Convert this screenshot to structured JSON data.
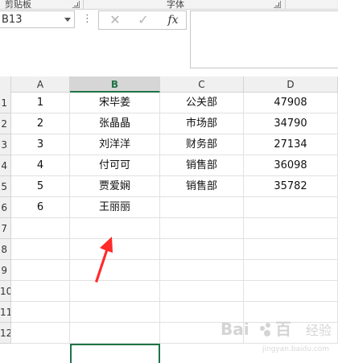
{
  "ribbon": {
    "clipboard_group": "剪贴板",
    "font_group": "字体"
  },
  "formula_bar": {
    "name_box": "B13",
    "more_icon": "vertical-dots-icon",
    "cancel_icon": "close-icon",
    "enter_icon": "check-icon",
    "insert_function_label": "fx",
    "value": ""
  },
  "sheet": {
    "columns": [
      "A",
      "B",
      "C",
      "D"
    ],
    "selected_column": "B",
    "row_headers": [
      "1",
      "2",
      "3",
      "4",
      "5",
      "6",
      "7",
      "8",
      "9",
      "10",
      "11",
      "12"
    ],
    "rows": [
      [
        "1",
        "宋毕姜",
        "公关部",
        "47908"
      ],
      [
        "2",
        "张晶晶",
        "市场部",
        "34790"
      ],
      [
        "3",
        "刘洋洋",
        "财务部",
        "27134"
      ],
      [
        "4",
        "付可可",
        "销售部",
        "36098"
      ],
      [
        "5",
        "贾爱娴",
        "销售部",
        "35782"
      ],
      [
        "6",
        "王丽丽",
        "",
        ""
      ],
      [
        "",
        "",
        "",
        ""
      ],
      [
        "",
        "",
        "",
        ""
      ],
      [
        "",
        "",
        "",
        ""
      ],
      [
        "",
        "",
        "",
        ""
      ],
      [
        "",
        "",
        "",
        ""
      ],
      [
        "",
        "",
        "",
        ""
      ]
    ],
    "active_cell": "B13"
  },
  "annotation": {
    "arrow_color": "#ff2a2a",
    "arrow_icon": "red-arrow-icon"
  },
  "watermark": {
    "text": "Bai 百度 经验",
    "sub": "jingyan.baidu.com"
  },
  "colors": {
    "accent": "#217346"
  }
}
